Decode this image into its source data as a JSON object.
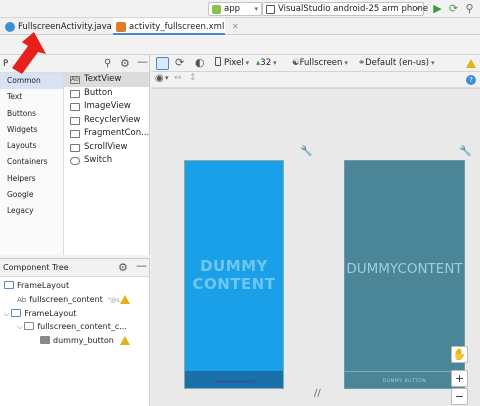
{
  "runbar": {
    "app_label": "app",
    "device_label": "VisualStudio android-25 arm phone"
  },
  "tabs": [
    {
      "label": "FullscreenActivity.java"
    },
    {
      "label": "activity_fullscreen.xml"
    }
  ],
  "toolbar": {
    "pixel_label": "Pixel",
    "api_label": "32",
    "theme_label": "Fullscreen",
    "locale_label": "Default (en-us)"
  },
  "palette": {
    "title": "P",
    "categories": [
      "Common",
      "Text",
      "Buttons",
      "Widgets",
      "Layouts",
      "Containers",
      "Helpers",
      "Google",
      "Legacy"
    ],
    "items": [
      "TextView",
      "Button",
      "ImageView",
      "RecyclerView",
      "FragmentCon...",
      "ScrollView",
      "Switch"
    ]
  },
  "tree": {
    "title": "Component Tree",
    "nodes": [
      {
        "label": "FrameLayout"
      },
      {
        "label": "fullscreen_content",
        "extra": "\"@s..."
      },
      {
        "label": "FrameLayout"
      },
      {
        "label": "fullscreen_content_c..."
      },
      {
        "label": "dummy_button"
      }
    ]
  },
  "design": {
    "text_line1": "DUMMY",
    "text_line2": "CONTENT",
    "blueprint_text": "DUMMYCONTENT",
    "blueprint_button": "DUMMY BUTTON"
  },
  "colors": {
    "design_bg": "#1aa0e8",
    "blueprint_bg": "#4a8697",
    "accent": "#4a88c7",
    "arrow": "#e8201c"
  }
}
